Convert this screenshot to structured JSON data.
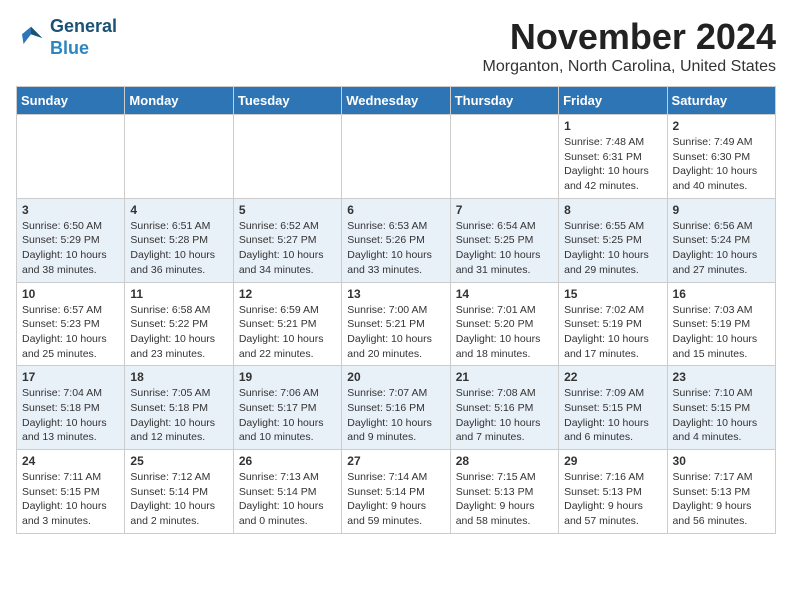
{
  "logo": {
    "line1": "General",
    "line2": "Blue"
  },
  "title": "November 2024",
  "location": "Morganton, North Carolina, United States",
  "weekdays": [
    "Sunday",
    "Monday",
    "Tuesday",
    "Wednesday",
    "Thursday",
    "Friday",
    "Saturday"
  ],
  "weeks": [
    [
      {
        "day": "",
        "info": ""
      },
      {
        "day": "",
        "info": ""
      },
      {
        "day": "",
        "info": ""
      },
      {
        "day": "",
        "info": ""
      },
      {
        "day": "",
        "info": ""
      },
      {
        "day": "1",
        "info": "Sunrise: 7:48 AM\nSunset: 6:31 PM\nDaylight: 10 hours and 42 minutes."
      },
      {
        "day": "2",
        "info": "Sunrise: 7:49 AM\nSunset: 6:30 PM\nDaylight: 10 hours and 40 minutes."
      }
    ],
    [
      {
        "day": "3",
        "info": "Sunrise: 6:50 AM\nSunset: 5:29 PM\nDaylight: 10 hours and 38 minutes."
      },
      {
        "day": "4",
        "info": "Sunrise: 6:51 AM\nSunset: 5:28 PM\nDaylight: 10 hours and 36 minutes."
      },
      {
        "day": "5",
        "info": "Sunrise: 6:52 AM\nSunset: 5:27 PM\nDaylight: 10 hours and 34 minutes."
      },
      {
        "day": "6",
        "info": "Sunrise: 6:53 AM\nSunset: 5:26 PM\nDaylight: 10 hours and 33 minutes."
      },
      {
        "day": "7",
        "info": "Sunrise: 6:54 AM\nSunset: 5:25 PM\nDaylight: 10 hours and 31 minutes."
      },
      {
        "day": "8",
        "info": "Sunrise: 6:55 AM\nSunset: 5:25 PM\nDaylight: 10 hours and 29 minutes."
      },
      {
        "day": "9",
        "info": "Sunrise: 6:56 AM\nSunset: 5:24 PM\nDaylight: 10 hours and 27 minutes."
      }
    ],
    [
      {
        "day": "10",
        "info": "Sunrise: 6:57 AM\nSunset: 5:23 PM\nDaylight: 10 hours and 25 minutes."
      },
      {
        "day": "11",
        "info": "Sunrise: 6:58 AM\nSunset: 5:22 PM\nDaylight: 10 hours and 23 minutes."
      },
      {
        "day": "12",
        "info": "Sunrise: 6:59 AM\nSunset: 5:21 PM\nDaylight: 10 hours and 22 minutes."
      },
      {
        "day": "13",
        "info": "Sunrise: 7:00 AM\nSunset: 5:21 PM\nDaylight: 10 hours and 20 minutes."
      },
      {
        "day": "14",
        "info": "Sunrise: 7:01 AM\nSunset: 5:20 PM\nDaylight: 10 hours and 18 minutes."
      },
      {
        "day": "15",
        "info": "Sunrise: 7:02 AM\nSunset: 5:19 PM\nDaylight: 10 hours and 17 minutes."
      },
      {
        "day": "16",
        "info": "Sunrise: 7:03 AM\nSunset: 5:19 PM\nDaylight: 10 hours and 15 minutes."
      }
    ],
    [
      {
        "day": "17",
        "info": "Sunrise: 7:04 AM\nSunset: 5:18 PM\nDaylight: 10 hours and 13 minutes."
      },
      {
        "day": "18",
        "info": "Sunrise: 7:05 AM\nSunset: 5:18 PM\nDaylight: 10 hours and 12 minutes."
      },
      {
        "day": "19",
        "info": "Sunrise: 7:06 AM\nSunset: 5:17 PM\nDaylight: 10 hours and 10 minutes."
      },
      {
        "day": "20",
        "info": "Sunrise: 7:07 AM\nSunset: 5:16 PM\nDaylight: 10 hours and 9 minutes."
      },
      {
        "day": "21",
        "info": "Sunrise: 7:08 AM\nSunset: 5:16 PM\nDaylight: 10 hours and 7 minutes."
      },
      {
        "day": "22",
        "info": "Sunrise: 7:09 AM\nSunset: 5:15 PM\nDaylight: 10 hours and 6 minutes."
      },
      {
        "day": "23",
        "info": "Sunrise: 7:10 AM\nSunset: 5:15 PM\nDaylight: 10 hours and 4 minutes."
      }
    ],
    [
      {
        "day": "24",
        "info": "Sunrise: 7:11 AM\nSunset: 5:15 PM\nDaylight: 10 hours and 3 minutes."
      },
      {
        "day": "25",
        "info": "Sunrise: 7:12 AM\nSunset: 5:14 PM\nDaylight: 10 hours and 2 minutes."
      },
      {
        "day": "26",
        "info": "Sunrise: 7:13 AM\nSunset: 5:14 PM\nDaylight: 10 hours and 0 minutes."
      },
      {
        "day": "27",
        "info": "Sunrise: 7:14 AM\nSunset: 5:14 PM\nDaylight: 9 hours and 59 minutes."
      },
      {
        "day": "28",
        "info": "Sunrise: 7:15 AM\nSunset: 5:13 PM\nDaylight: 9 hours and 58 minutes."
      },
      {
        "day": "29",
        "info": "Sunrise: 7:16 AM\nSunset: 5:13 PM\nDaylight: 9 hours and 57 minutes."
      },
      {
        "day": "30",
        "info": "Sunrise: 7:17 AM\nSunset: 5:13 PM\nDaylight: 9 hours and 56 minutes."
      }
    ]
  ]
}
